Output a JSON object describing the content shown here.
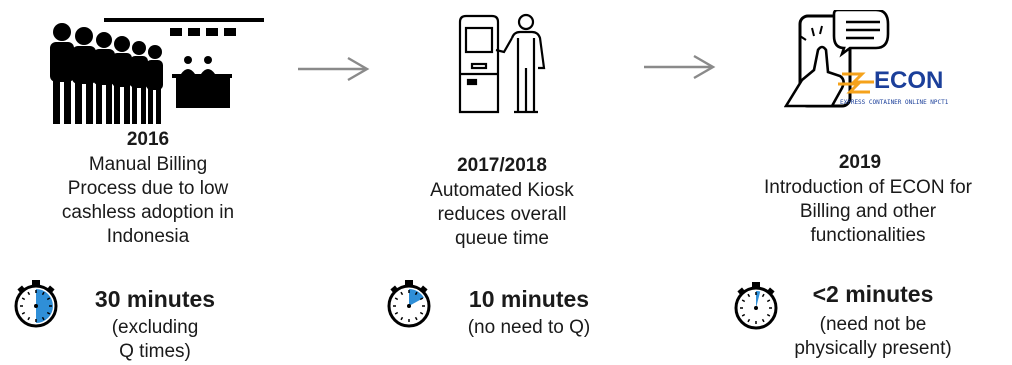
{
  "stages": [
    {
      "year": "2016",
      "desc_lines": [
        "Manual Billing",
        "Process due to low",
        "cashless adoption in",
        "Indonesia"
      ],
      "time": "30 minutes",
      "note_lines": [
        "(excluding",
        "Q times)"
      ],
      "timer_fraction": 0.5,
      "icon": "queue-icon"
    },
    {
      "year": "2017/2018",
      "desc_lines": [
        "Automated Kiosk",
        "reduces overall",
        "queue time"
      ],
      "time": "10 minutes",
      "note_lines": [
        "(no need to Q)"
      ],
      "timer_fraction": 0.17,
      "icon": "kiosk-icon"
    },
    {
      "year": "2019",
      "desc_lines": [
        "Introduction of ECON for",
        "Billing and other",
        "functionalities"
      ],
      "time": "<2 minutes",
      "note_lines": [
        "(need not be",
        "physically present)"
      ],
      "timer_fraction": 0.04,
      "icon": "mobile-icon"
    }
  ],
  "econ_logo": {
    "word": "ECON",
    "tagline": "EXPRESS CONTAINER ONLINE NPCT1"
  },
  "colors": {
    "timer_fill": "#2f8fd8",
    "econ_blue": "#1b3f9a",
    "econ_orange": "#f5a21b",
    "arrow": "#8a8a8a"
  }
}
